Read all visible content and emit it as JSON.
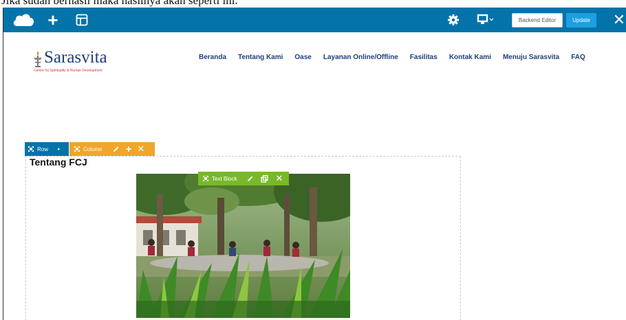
{
  "caption": "Jika sudah berhasil maka hasilnya akan seperti ini.",
  "editor_toolbar": {
    "backend_editor_label": "Backend Editor",
    "update_label": "Update"
  },
  "site": {
    "logo_name": "Sarasvita",
    "logo_tagline": "Centre for Spirituality & Human Development",
    "nav": [
      "Beranda",
      "Tentang Kami",
      "Oase",
      "Layanan Online/Offline",
      "Fasilitas",
      "Kontak Kami",
      "Menuju Sarasvita",
      "FAQ"
    ]
  },
  "builder": {
    "row_label": "Row",
    "column_label": "Column",
    "text_block_label": "Text Block",
    "section_title": "Tentang FCJ"
  },
  "colors": {
    "toolbar": "#0473aa",
    "update": "#1d9fe0",
    "column": "#f0a52b",
    "text_block": "#78b82a",
    "brand_blue": "#1f3f77"
  },
  "icons": {
    "logo": "cloud-logo-icon",
    "add": "plus-icon",
    "layout": "layout-icon",
    "settings": "gear-icon",
    "responsive": "monitor-icon",
    "close": "close-icon"
  }
}
